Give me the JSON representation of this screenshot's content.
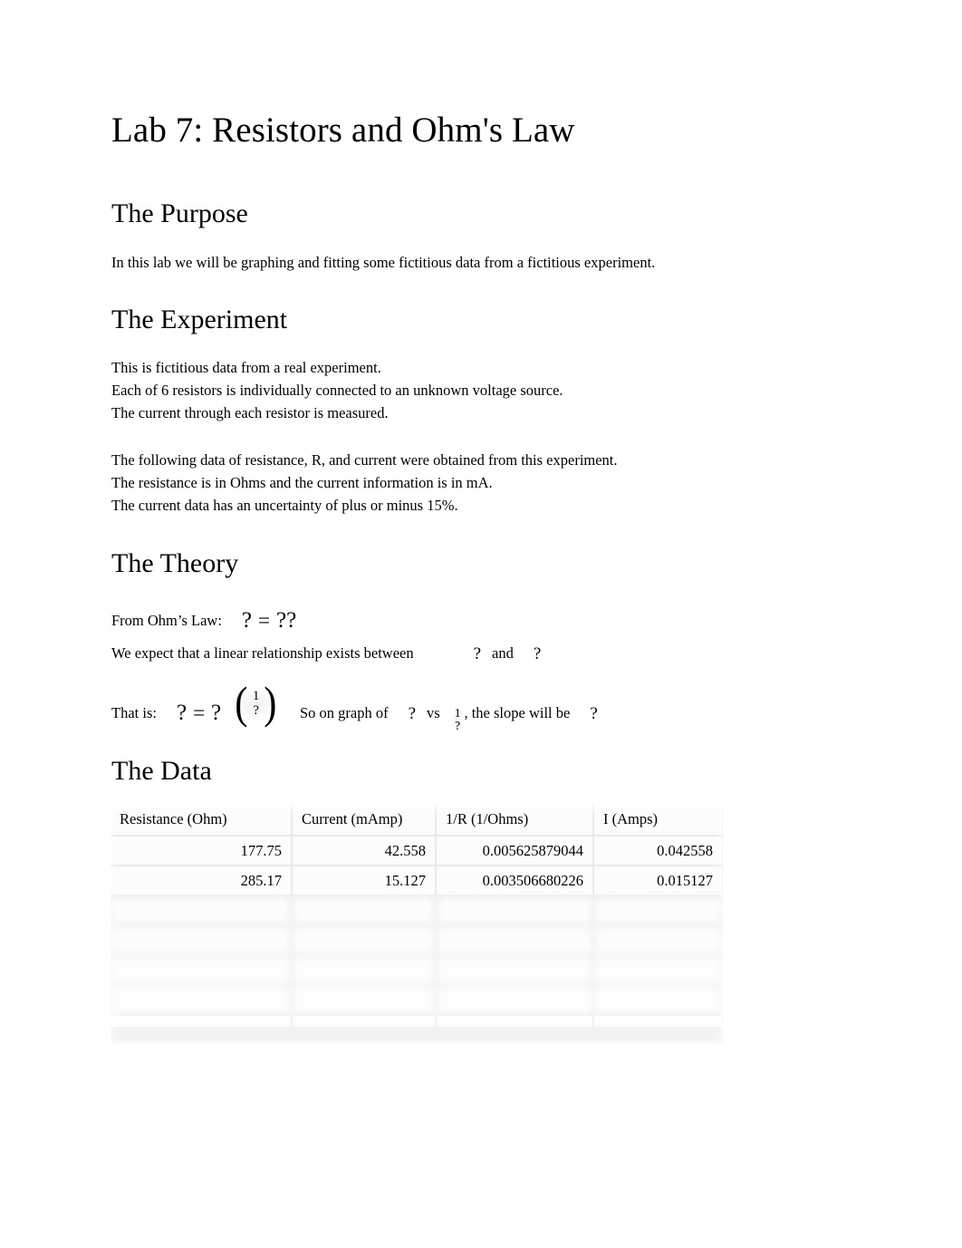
{
  "document": {
    "title": "Lab 7: Resistors and Ohm's Law"
  },
  "sections": {
    "purpose": {
      "heading": "The Purpose",
      "paragraph": "In this lab we will be graphing and fitting some fictitious data from a fictitious experiment."
    },
    "experiment": {
      "heading": "The Experiment",
      "block1_line1": "This is fictitious data from a real experiment.",
      "block1_line2": "Each of 6 resistors is individually connected to an unknown voltage source.",
      "block1_line3": "The current through each resistor is measured.",
      "block2_line1": "The following data of resistance, R, and current were obtained from this experiment.",
      "block2_line2": "The resistance is in Ohms and the current information is in mA.",
      "block2_line3": "The current data has an uncertainty of plus or minus 15%."
    },
    "theory": {
      "heading": "The Theory",
      "ohms_law_label": "From Ohm’s Law:",
      "ohms_law_lhs": "?",
      "ohms_law_eq": "=",
      "ohms_law_rhs": "??",
      "relation_text": "We expect that a linear relationship exists between",
      "relation_var1": "?",
      "relation_and": "and",
      "relation_var2": "?",
      "that_is_label": "That is:",
      "that_is_lhs": "?",
      "that_is_eq": "=",
      "that_is_coef": "?",
      "paren_open": "(",
      "paren_close": ")",
      "frac_numerator": "1",
      "frac_denominator": "?",
      "so_on_graph_text": "So on graph of",
      "graph_var_y": "?",
      "vs_text": "vs",
      "inline_frac_num": "1",
      "inline_frac_den": "?",
      "slope_text": ", the slope will be",
      "slope_var": "?"
    },
    "data": {
      "heading": "The Data"
    }
  },
  "chart_data": {
    "type": "table",
    "title": "The Data",
    "columns": [
      "Resistance (Ohm)",
      "Current (mAmp)",
      "1/R (1/Ohms)",
      "I (Amps)"
    ],
    "rows": [
      [
        "177.75",
        "42.558",
        "0.005625879044",
        "0.042558"
      ],
      [
        "285.17",
        "15.127",
        "0.003506680226",
        "0.015127"
      ]
    ],
    "hidden_rows": [
      [
        "",
        "",
        "",
        ""
      ],
      [
        "",
        "",
        "",
        ""
      ],
      [
        "",
        "",
        "",
        ""
      ],
      [
        "",
        "",
        "",
        ""
      ]
    ],
    "hidden_row_note": "remaining rows obscured by blur",
    "total_rows_expected": 6
  },
  "colors": {
    "page_background": "#ffffff",
    "text": "#000000",
    "table_grid": "#e9e9e9",
    "table_cell": "#fcfcfc"
  }
}
